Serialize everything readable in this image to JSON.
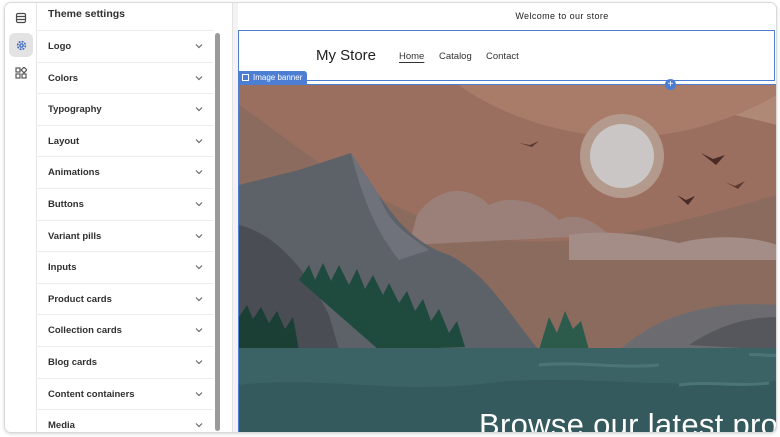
{
  "sidebar": {
    "title": "Theme settings",
    "items": [
      {
        "label": "Logo"
      },
      {
        "label": "Colors"
      },
      {
        "label": "Typography"
      },
      {
        "label": "Layout"
      },
      {
        "label": "Animations"
      },
      {
        "label": "Buttons"
      },
      {
        "label": "Variant pills"
      },
      {
        "label": "Inputs"
      },
      {
        "label": "Product cards"
      },
      {
        "label": "Collection cards"
      },
      {
        "label": "Blog cards"
      },
      {
        "label": "Content containers"
      },
      {
        "label": "Media"
      }
    ]
  },
  "rail": {
    "icons": [
      "sections-icon",
      "settings-gear-icon",
      "apps-icon"
    ],
    "active": "settings-gear-icon"
  },
  "preview": {
    "announcement": "Welcome to our store",
    "store_name": "My Store",
    "nav": {
      "home": "Home",
      "catalog": "Catalog",
      "contact": "Contact"
    },
    "banner_tag": "Image banner",
    "banner_heading": "Browse our latest pro"
  },
  "colors": {
    "selection": "#4c7ed3",
    "sky": "#9a6f60",
    "water": "#3b6366",
    "active_rail": "#e3e3e3"
  }
}
